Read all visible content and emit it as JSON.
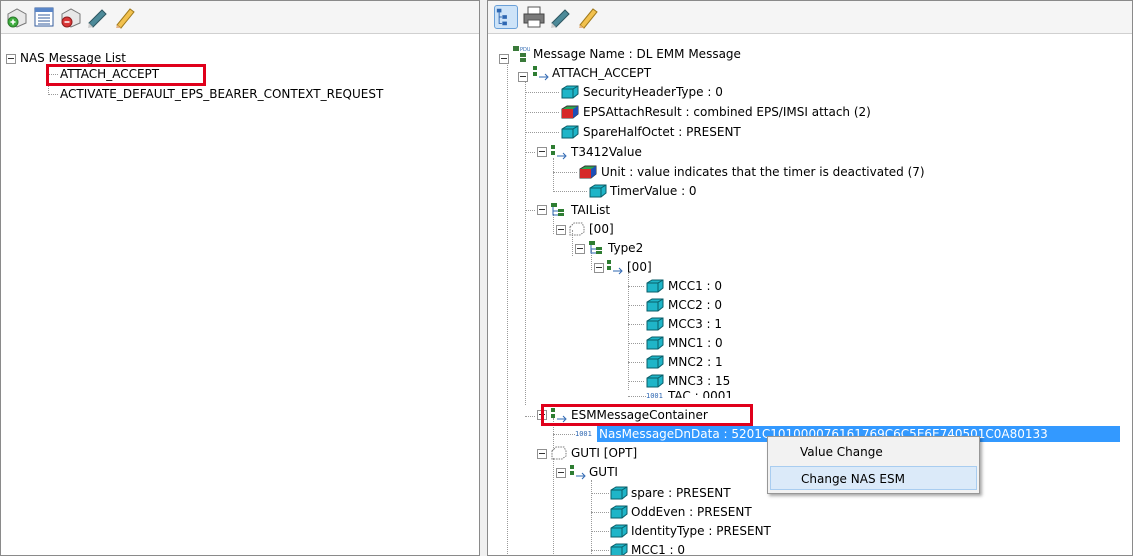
{
  "left_panel": {
    "toolbar_icons": [
      "add-message-icon",
      "list-view-icon",
      "delete-message-icon",
      "edit-pen-icon",
      "pencil-icon"
    ],
    "tree": {
      "root": "NAS Message List",
      "items": [
        "ATTACH_ACCEPT",
        "ACTIVATE_DEFAULT_EPS_BEARER_CONTEXT_REQUEST"
      ]
    }
  },
  "right_panel": {
    "toolbar_icons": [
      "tree-view-icon",
      "print-icon",
      "edit-pen-icon",
      "pencil-icon"
    ],
    "tree": {
      "message_name": "Message Name : DL EMM Message",
      "attach_accept": "ATTACH_ACCEPT",
      "security_header": "SecurityHeaderType : 0",
      "eps_attach_result": "EPSAttachResult : combined EPS/IMSI attach (2)",
      "spare_half_octet": "SpareHalfOctet : PRESENT",
      "t3412": "T3412Value",
      "unit": "Unit : value indicates that the timer is deactivated (7)",
      "timer_value": "TimerValue : 0",
      "tai_list": "TAIList",
      "idx_00": "[00]",
      "type2": "Type2",
      "idx_00b": "[00]",
      "mcc1": "MCC1 : 0",
      "mcc2": "MCC2 : 0",
      "mcc3": "MCC3 : 1",
      "mnc1": "MNC1 : 0",
      "mnc2": "MNC2 : 1",
      "mnc3": "MNC3 : 15",
      "tac": "TAC : 0001",
      "esm_container": "ESMMessageContainer",
      "nas_dn_data": "NasMessageDnData : 5201C101000076161769C6C5E6E740501C0A80133",
      "guti_opt": "GUTI [OPT]",
      "guti": "GUTI",
      "spare": "spare : PRESENT",
      "odd_even": "OddEven : PRESENT",
      "identity_type": "IdentityType : PRESENT",
      "guti_mcc1": "MCC1 : 0"
    }
  },
  "context_menu": {
    "items": [
      "Value Change",
      "Change NAS ESM"
    ],
    "highlighted": "Change NAS ESM"
  },
  "colors": {
    "selection": "#3399ff",
    "highlight_box": "#e0001b",
    "gem_cyan": "#1fb5c8"
  }
}
